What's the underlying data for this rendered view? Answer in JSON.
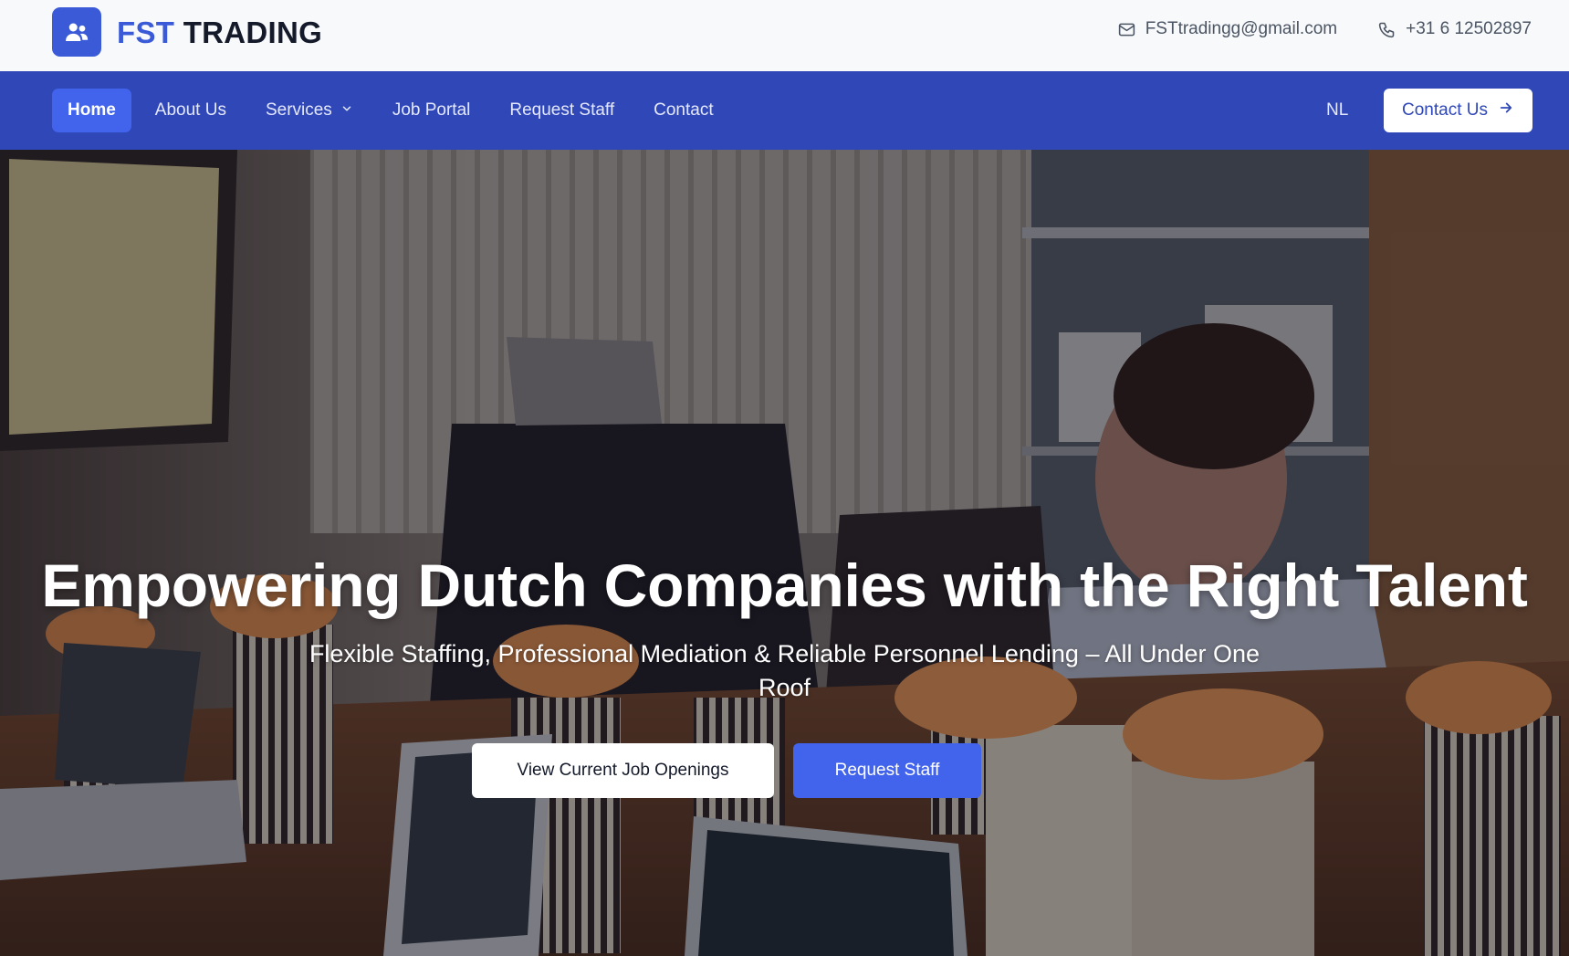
{
  "brand": {
    "name_highlight": "FST",
    "name_rest": " TRADING",
    "logo_icon": "users-icon"
  },
  "contact": {
    "email": "FSTtradingg@gmail.com",
    "email_icon": "mail-icon",
    "phone": "+31 6 12502897",
    "phone_icon": "phone-icon"
  },
  "nav": {
    "items": [
      {
        "label": "Home",
        "active": true
      },
      {
        "label": "About Us"
      },
      {
        "label": "Services",
        "has_dropdown": true
      },
      {
        "label": "Job Portal"
      },
      {
        "label": "Request Staff"
      },
      {
        "label": "Contact"
      }
    ],
    "language": "NL",
    "cta_label": "Contact Us",
    "cta_icon": "arrow-right-icon"
  },
  "hero": {
    "title": "Empowering Dutch Companies with the Right Talent",
    "subtitle": "Flexible Staffing, Professional Mediation & Reliable Personnel Lending – All Under One Roof",
    "primary_button": "View Current Job Openings",
    "secondary_button": "Request Staff"
  },
  "colors": {
    "brand_blue": "#3a5ad8",
    "nav_bg": "#2f47b7",
    "nav_active": "#4263ec",
    "topbar_bg": "#f8f9fb",
    "button_blue": "#4263ec"
  }
}
